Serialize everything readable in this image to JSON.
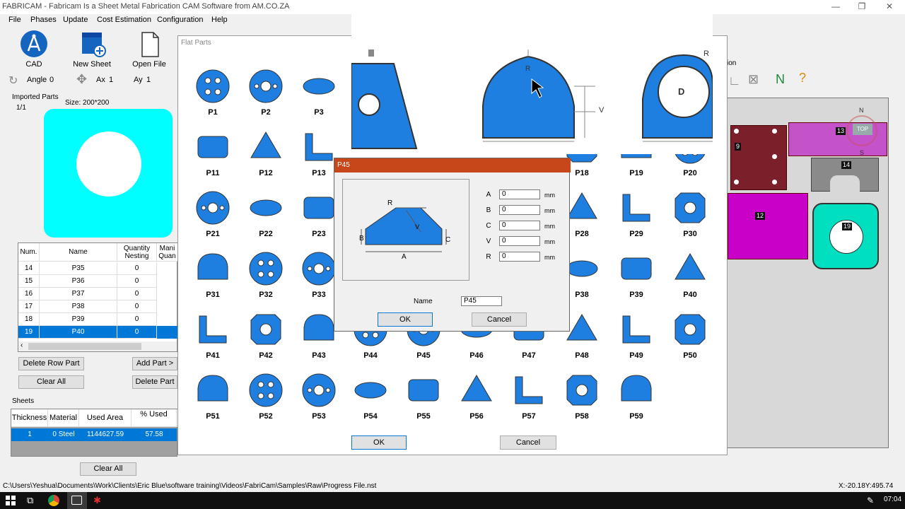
{
  "window": {
    "title": "FABRICAM - Fabricam Is a Sheet Metal Fabrication CAM Software from AM.CO.ZA",
    "min": "—",
    "max": "❐",
    "close": "✕"
  },
  "menu": [
    "File",
    "Phases",
    "Update",
    "Cost Estimation",
    "Configuration",
    "Help"
  ],
  "toolbar": {
    "cad_label": "CAD",
    "new_sheet_label": "New Sheet",
    "open_file_label": "Open File",
    "angle_label": "Angle",
    "angle_value": "0",
    "ax_label": "Ax",
    "ax_value": "1",
    "ay_label": "Ay",
    "ay_value": "1"
  },
  "imported": {
    "title": "Imported Parts",
    "page": "1/1",
    "size": "Size: 200*200",
    "headers": [
      "Num.",
      "Name",
      "Quantity Nesting",
      "Mani Quan"
    ],
    "rows": [
      {
        "num": "14",
        "name": "P35",
        "qty": "0"
      },
      {
        "num": "15",
        "name": "P36",
        "qty": "0"
      },
      {
        "num": "16",
        "name": "P37",
        "qty": "0"
      },
      {
        "num": "17",
        "name": "P38",
        "qty": "0"
      },
      {
        "num": "18",
        "name": "P39",
        "qty": "0"
      },
      {
        "num": "19",
        "name": "P40",
        "qty": "0"
      }
    ],
    "delete_row": "Delete Row Part",
    "add_part": "Add Part >",
    "clear_all": "Clear All",
    "delete_part": "Delete Part"
  },
  "sheets": {
    "title": "Sheets",
    "headers": [
      "Thickness",
      "Material",
      "Used Area",
      "% Used"
    ],
    "row": {
      "thickness": "1",
      "material": "0  Steel",
      "area": "1144627.59",
      "used": "57.58"
    },
    "clear_all": "Clear All"
  },
  "flat": {
    "title": "Flat Parts",
    "ok": "OK",
    "cancel": "Cancel",
    "parts": [
      "P1",
      "P2",
      "P3",
      "P11",
      "P12",
      "P13",
      "P18",
      "P19",
      "P20",
      "P21",
      "P22",
      "P23",
      "P28",
      "P29",
      "P30",
      "P31",
      "P32",
      "P33",
      "P38",
      "P39",
      "P40",
      "P41",
      "P42",
      "P43",
      "P44",
      "P45",
      "P46",
      "P47",
      "P48",
      "P49",
      "P50",
      "P51",
      "P52",
      "P53",
      "P54",
      "P55",
      "P56",
      "P57",
      "P58",
      "P59"
    ]
  },
  "dialog": {
    "title": "P45",
    "fields": [
      {
        "label": "A",
        "value": "0",
        "unit": "mm"
      },
      {
        "label": "B",
        "value": "0",
        "unit": "mm"
      },
      {
        "label": "C",
        "value": "0",
        "unit": "mm"
      },
      {
        "label": "V",
        "value": "0",
        "unit": "mm"
      },
      {
        "label": "R",
        "value": "0",
        "unit": "mm"
      }
    ],
    "shape_labels": {
      "r": "R",
      "v": "V",
      "b": "B",
      "c": "C",
      "a": "A"
    },
    "name_label": "Name",
    "name_value": "P45",
    "ok": "OK",
    "cancel": "Cancel"
  },
  "preview": {
    "r": "R",
    "v": "V",
    "d": "D"
  },
  "nest": {
    "compass_n": "N",
    "compass_s": "S",
    "compass_top": "TOP",
    "labels": [
      "9",
      "13",
      "14",
      "12",
      "19"
    ],
    "option_frag": "ion"
  },
  "status": {
    "path": "C:\\Users\\Yeshua\\Documents\\Work\\Clients\\Eric Blue\\software training\\Videos\\FabriCam\\Samples\\Raw\\Progress File.nst",
    "coords": "X:-20.18Y:495.74"
  },
  "taskbar": {
    "time": "07:04"
  },
  "colors": {
    "part_blue": "#1e7fe0",
    "cyan": "#00ffff",
    "select": "#0078d7",
    "dialog_title": "#c8471a"
  }
}
